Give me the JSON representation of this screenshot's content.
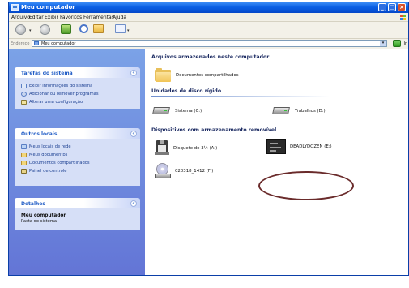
{
  "window": {
    "title": "Meu computador"
  },
  "menu": {
    "items": [
      "Arquivo",
      "Editar",
      "Exibir",
      "Favoritos",
      "Ferramentas",
      "Ajuda"
    ]
  },
  "address": {
    "label": "Endereço",
    "value": "Meu computador",
    "go_label": "Ir"
  },
  "sidebar": {
    "tasks": {
      "title": "Tarefas do sistema",
      "items": [
        "Exibir informações do sistema",
        "Adicionar ou remover programas",
        "Alterar uma configuração"
      ]
    },
    "places": {
      "title": "Outros locais",
      "items": [
        "Meus locais de rede",
        "Meus documentos",
        "Documentos compartilhados",
        "Painel de controle"
      ]
    },
    "details": {
      "title": "Detalhes",
      "name": "Meu computador",
      "subtitle": "Pasta do sistema"
    }
  },
  "content": {
    "groups": [
      {
        "title": "Arquivos armazenados neste computador",
        "items": [
          "Documentos compartilhados"
        ]
      },
      {
        "title": "Unidades de disco rígido",
        "items": [
          "Sistema (C:)",
          "Trabalhos (D:)"
        ]
      },
      {
        "title": "Dispositivos com armazenamento removível",
        "items": [
          "Disquete de 3½ (A:)",
          "DEADLYDOZEN (E:)",
          "020318_1412 (F:)"
        ]
      }
    ]
  },
  "colors": {
    "title_bar": "#0a5fe4",
    "sidebar_bg": "#6f8fe0",
    "panel_bg": "#d6dff7",
    "panel_title": "#215dc6",
    "highlight_oval": "#6a2b2b"
  }
}
